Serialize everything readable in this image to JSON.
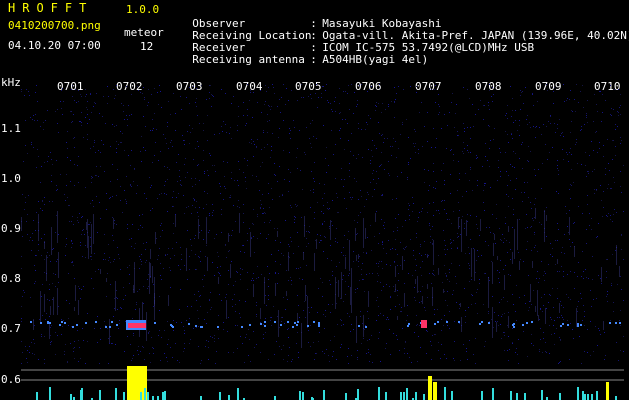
{
  "header": {
    "title": "HROFFT",
    "version": "1.0.0",
    "filename": "0410200700.png",
    "datetime": "04.10.20 07:00",
    "meteor_label": "meteor",
    "meteor_count": "12"
  },
  "info": [
    {
      "label": "Observer",
      "value": "Masayuki Kobayashi"
    },
    {
      "label": "Receiving Location",
      "value": "Ogata-vill. Akita-Pref. JAPAN (139.96E, 40.02N)"
    },
    {
      "label": "Receiver",
      "value": "ICOM IC-575 53.7492(@LCD)MHz USB"
    },
    {
      "label": "Receiving antenna",
      "value": "A504HB(yagi 4el)"
    }
  ],
  "axis": {
    "y_unit": "kHz",
    "y_ticks": [
      "1.1",
      "1.0",
      "0.9",
      "0.8",
      "0.7",
      "0.6"
    ],
    "x_ticks": [
      "0701",
      "0702",
      "0703",
      "0704",
      "0705",
      "0706",
      "0707",
      "0708",
      "0709",
      "0710"
    ]
  },
  "colors": {
    "background": "#000000",
    "text_yellow": "#ffff00",
    "text_white": "#ffffff",
    "noise": "#1a1a6e",
    "signal_red": "#ff3366",
    "signal_blue": "#4488ff",
    "level_yellow": "#ffff00",
    "level_cyan": "#33dddd"
  }
}
